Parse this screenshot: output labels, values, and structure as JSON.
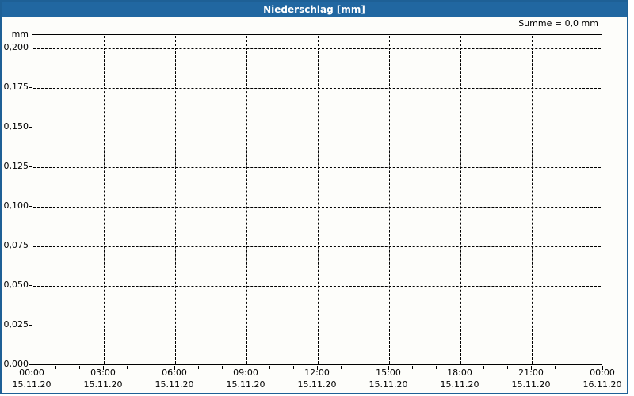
{
  "window": {
    "title": "Niederschlag [mm]"
  },
  "colors": {
    "titlebar_blue": "#2167a1",
    "border_blue": "#1e6096",
    "background": "#fdfdfa",
    "grid": "#000000",
    "text": "#000000",
    "title_text": "#ffffff"
  },
  "chart_data": {
    "type": "bar",
    "title": "Niederschlag [mm]",
    "ylabel": "mm",
    "summary": "Summe = 0,0 mm",
    "sum_mm": 0.0,
    "ylim": [
      0,
      0.2085
    ],
    "ytick_step": 0.025,
    "yticks": [
      "0,000",
      "0,025",
      "0,050",
      "0,075",
      "0,100",
      "0,125",
      "0,150",
      "0,175",
      "0,200"
    ],
    "x_range": {
      "start_time": "00:00",
      "start_date": "15.11.20",
      "end_time": "00:00",
      "end_date": "16.11.20"
    },
    "x_major_step_hours": 3,
    "x_minor_step_hours": 1,
    "xticks": [
      {
        "time": "00:00",
        "date": "15.11.20"
      },
      {
        "time": "03:00",
        "date": "15.11.20"
      },
      {
        "time": "06:00",
        "date": "15.11.20"
      },
      {
        "time": "09:00",
        "date": "15.11.20"
      },
      {
        "time": "12:00",
        "date": "15.11.20"
      },
      {
        "time": "15:00",
        "date": "15.11.20"
      },
      {
        "time": "18:00",
        "date": "15.11.20"
      },
      {
        "time": "21:00",
        "date": "15.11.20"
      },
      {
        "time": "00:00",
        "date": "16.11.20"
      }
    ],
    "series": [
      {
        "name": "Niederschlag",
        "values": []
      }
    ],
    "grid_style": "dashed",
    "legend": "none"
  }
}
